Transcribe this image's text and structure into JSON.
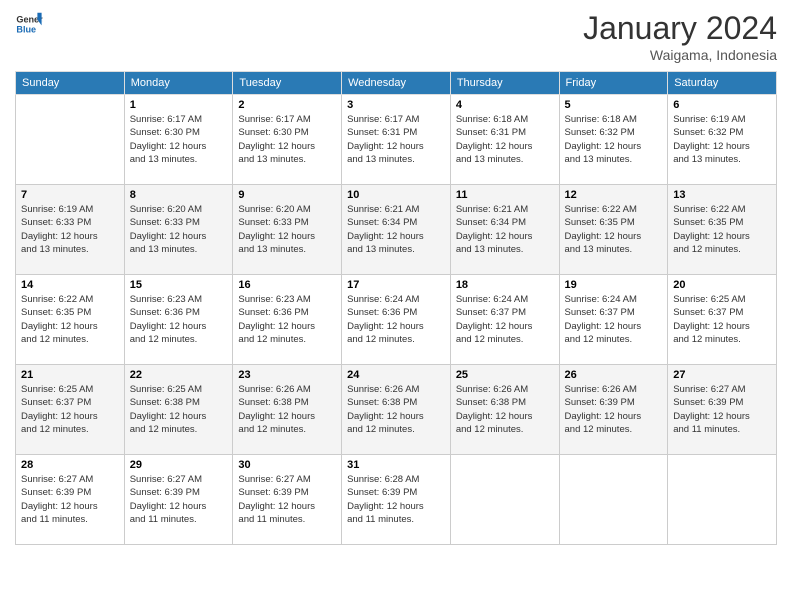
{
  "header": {
    "logo_general": "General",
    "logo_blue": "Blue",
    "title": "January 2024",
    "location": "Waigama, Indonesia"
  },
  "columns": [
    "Sunday",
    "Monday",
    "Tuesday",
    "Wednesday",
    "Thursday",
    "Friday",
    "Saturday"
  ],
  "weeks": [
    {
      "days": [
        {
          "num": "",
          "info": ""
        },
        {
          "num": "1",
          "info": "Sunrise: 6:17 AM\nSunset: 6:30 PM\nDaylight: 12 hours\nand 13 minutes."
        },
        {
          "num": "2",
          "info": "Sunrise: 6:17 AM\nSunset: 6:30 PM\nDaylight: 12 hours\nand 13 minutes."
        },
        {
          "num": "3",
          "info": "Sunrise: 6:17 AM\nSunset: 6:31 PM\nDaylight: 12 hours\nand 13 minutes."
        },
        {
          "num": "4",
          "info": "Sunrise: 6:18 AM\nSunset: 6:31 PM\nDaylight: 12 hours\nand 13 minutes."
        },
        {
          "num": "5",
          "info": "Sunrise: 6:18 AM\nSunset: 6:32 PM\nDaylight: 12 hours\nand 13 minutes."
        },
        {
          "num": "6",
          "info": "Sunrise: 6:19 AM\nSunset: 6:32 PM\nDaylight: 12 hours\nand 13 minutes."
        }
      ]
    },
    {
      "days": [
        {
          "num": "7",
          "info": "Sunrise: 6:19 AM\nSunset: 6:33 PM\nDaylight: 12 hours\nand 13 minutes."
        },
        {
          "num": "8",
          "info": "Sunrise: 6:20 AM\nSunset: 6:33 PM\nDaylight: 12 hours\nand 13 minutes."
        },
        {
          "num": "9",
          "info": "Sunrise: 6:20 AM\nSunset: 6:33 PM\nDaylight: 12 hours\nand 13 minutes."
        },
        {
          "num": "10",
          "info": "Sunrise: 6:21 AM\nSunset: 6:34 PM\nDaylight: 12 hours\nand 13 minutes."
        },
        {
          "num": "11",
          "info": "Sunrise: 6:21 AM\nSunset: 6:34 PM\nDaylight: 12 hours\nand 13 minutes."
        },
        {
          "num": "12",
          "info": "Sunrise: 6:22 AM\nSunset: 6:35 PM\nDaylight: 12 hours\nand 13 minutes."
        },
        {
          "num": "13",
          "info": "Sunrise: 6:22 AM\nSunset: 6:35 PM\nDaylight: 12 hours\nand 12 minutes."
        }
      ]
    },
    {
      "days": [
        {
          "num": "14",
          "info": "Sunrise: 6:22 AM\nSunset: 6:35 PM\nDaylight: 12 hours\nand 12 minutes."
        },
        {
          "num": "15",
          "info": "Sunrise: 6:23 AM\nSunset: 6:36 PM\nDaylight: 12 hours\nand 12 minutes."
        },
        {
          "num": "16",
          "info": "Sunrise: 6:23 AM\nSunset: 6:36 PM\nDaylight: 12 hours\nand 12 minutes."
        },
        {
          "num": "17",
          "info": "Sunrise: 6:24 AM\nSunset: 6:36 PM\nDaylight: 12 hours\nand 12 minutes."
        },
        {
          "num": "18",
          "info": "Sunrise: 6:24 AM\nSunset: 6:37 PM\nDaylight: 12 hours\nand 12 minutes."
        },
        {
          "num": "19",
          "info": "Sunrise: 6:24 AM\nSunset: 6:37 PM\nDaylight: 12 hours\nand 12 minutes."
        },
        {
          "num": "20",
          "info": "Sunrise: 6:25 AM\nSunset: 6:37 PM\nDaylight: 12 hours\nand 12 minutes."
        }
      ]
    },
    {
      "days": [
        {
          "num": "21",
          "info": "Sunrise: 6:25 AM\nSunset: 6:37 PM\nDaylight: 12 hours\nand 12 minutes."
        },
        {
          "num": "22",
          "info": "Sunrise: 6:25 AM\nSunset: 6:38 PM\nDaylight: 12 hours\nand 12 minutes."
        },
        {
          "num": "23",
          "info": "Sunrise: 6:26 AM\nSunset: 6:38 PM\nDaylight: 12 hours\nand 12 minutes."
        },
        {
          "num": "24",
          "info": "Sunrise: 6:26 AM\nSunset: 6:38 PM\nDaylight: 12 hours\nand 12 minutes."
        },
        {
          "num": "25",
          "info": "Sunrise: 6:26 AM\nSunset: 6:38 PM\nDaylight: 12 hours\nand 12 minutes."
        },
        {
          "num": "26",
          "info": "Sunrise: 6:26 AM\nSunset: 6:39 PM\nDaylight: 12 hours\nand 12 minutes."
        },
        {
          "num": "27",
          "info": "Sunrise: 6:27 AM\nSunset: 6:39 PM\nDaylight: 12 hours\nand 11 minutes."
        }
      ]
    },
    {
      "days": [
        {
          "num": "28",
          "info": "Sunrise: 6:27 AM\nSunset: 6:39 PM\nDaylight: 12 hours\nand 11 minutes."
        },
        {
          "num": "29",
          "info": "Sunrise: 6:27 AM\nSunset: 6:39 PM\nDaylight: 12 hours\nand 11 minutes."
        },
        {
          "num": "30",
          "info": "Sunrise: 6:27 AM\nSunset: 6:39 PM\nDaylight: 12 hours\nand 11 minutes."
        },
        {
          "num": "31",
          "info": "Sunrise: 6:28 AM\nSunset: 6:39 PM\nDaylight: 12 hours\nand 11 minutes."
        },
        {
          "num": "",
          "info": ""
        },
        {
          "num": "",
          "info": ""
        },
        {
          "num": "",
          "info": ""
        }
      ]
    }
  ]
}
